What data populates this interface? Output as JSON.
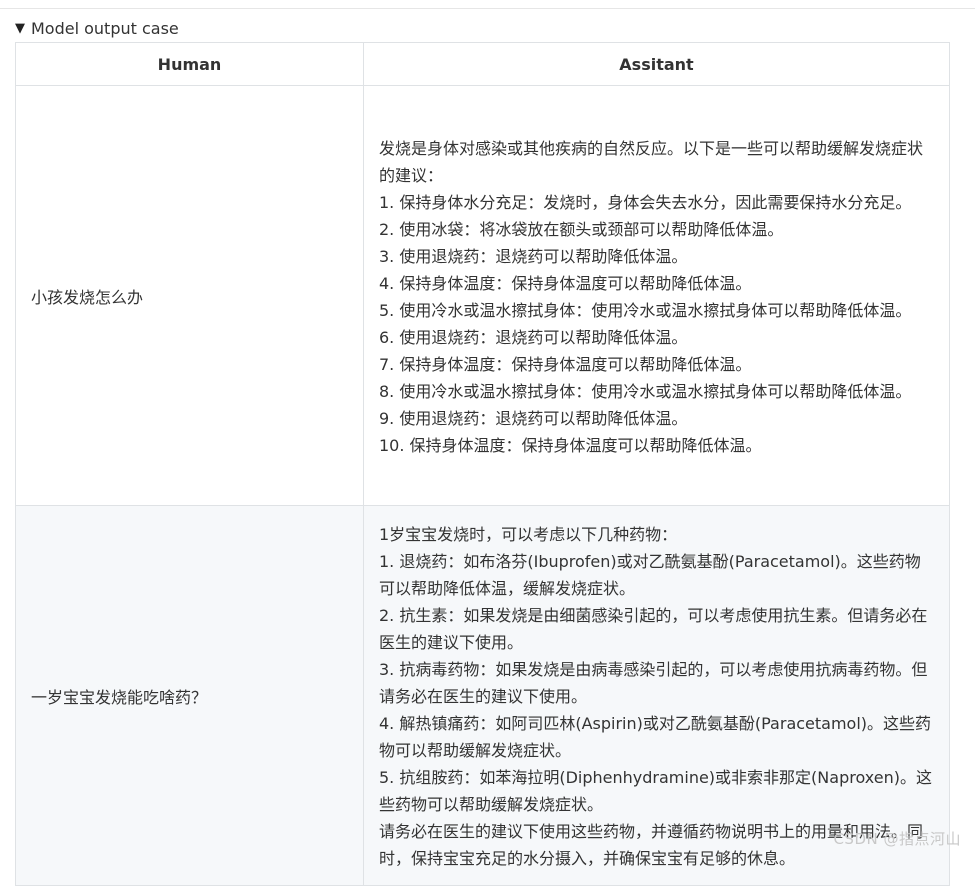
{
  "summary": "Model output case",
  "table": {
    "headers": [
      "Human",
      "Assitant"
    ],
    "rows": [
      {
        "human": "小孩发烧怎么办",
        "assistant_lines": [
          "发烧是身体对感染或其他疾病的自然反应。以下是一些可以帮助缓解发烧症状的建议：",
          "1. 保持身体水分充足：发烧时，身体会失去水分，因此需要保持水分充足。",
          "2. 使用冰袋：将冰袋放在额头或颈部可以帮助降低体温。",
          "3. 使用退烧药：退烧药可以帮助降低体温。",
          "4. 保持身体温度：保持身体温度可以帮助降低体温。",
          "5. 使用冷水或温水擦拭身体：使用冷水或温水擦拭身体可以帮助降低体温。",
          "6. 使用退烧药：退烧药可以帮助降低体温。",
          "7. 保持身体温度：保持身体温度可以帮助降低体温。",
          "8. 使用冷水或温水擦拭身体：使用冷水或温水擦拭身体可以帮助降低体温。",
          "9. 使用退烧药：退烧药可以帮助降低体温。",
          "10. 保持身体温度：保持身体温度可以帮助降低体温。"
        ]
      },
      {
        "human": "一岁宝宝发烧能吃啥药？",
        "assistant_lines": [
          "1岁宝宝发烧时，可以考虑以下几种药物：",
          "1. 退烧药：如布洛芬(Ibuprofen)或对乙酰氨基酚(Paracetamol)。这些药物可以帮助降低体温，缓解发烧症状。",
          "2. 抗生素：如果发烧是由细菌感染引起的，可以考虑使用抗生素。但请务必在医生的建议下使用。",
          "3. 抗病毒药物：如果发烧是由病毒感染引起的，可以考虑使用抗病毒药物。但请务必在医生的建议下使用。",
          "4. 解热镇痛药：如阿司匹林(Aspirin)或对乙酰氨基酚(Paracetamol)。这些药物可以帮助缓解发烧症状。",
          "5. 抗组胺药：如苯海拉明(Diphenhydramine)或非索非那定(Naproxen)。这些药物可以帮助缓解发烧症状。",
          "请务必在医生的建议下使用这些药物，并遵循药物说明书上的用量和用法。同时，保持宝宝充足的水分摄入，并确保宝宝有足够的休息。"
        ]
      }
    ]
  },
  "watermark": "CSDN @指点河山"
}
